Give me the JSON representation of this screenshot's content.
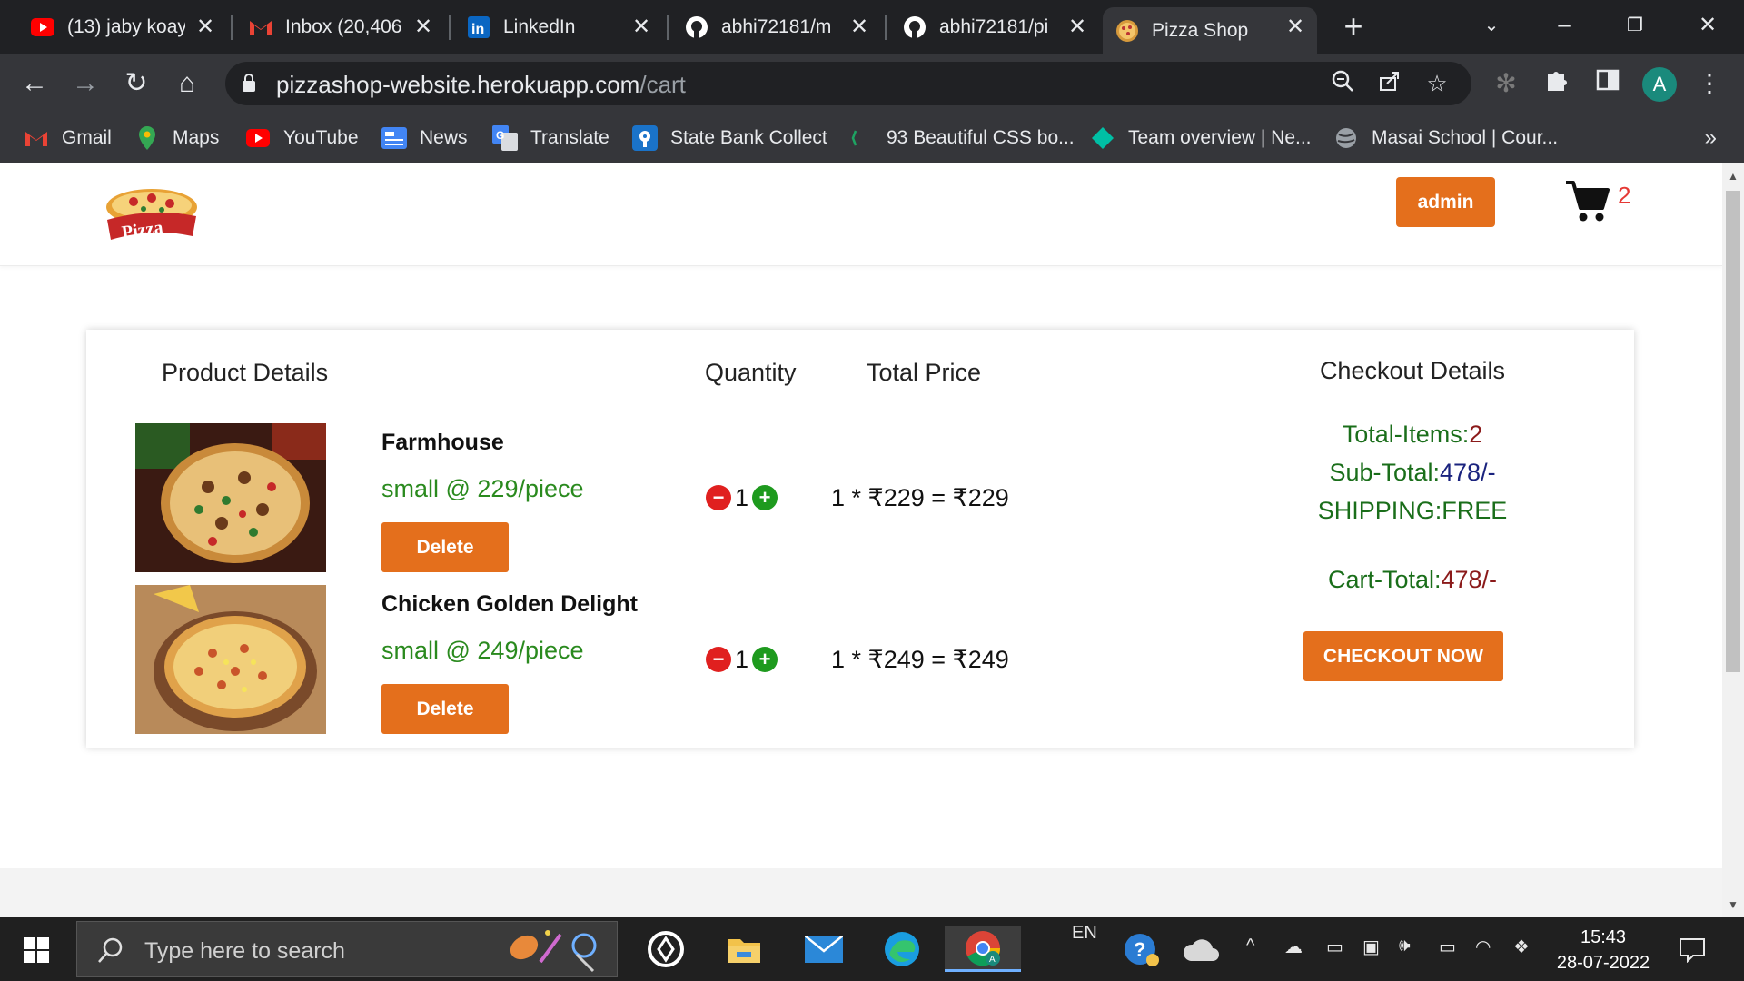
{
  "browser": {
    "tabs": [
      {
        "title": "(13) jaby koay",
        "icon": "youtube-icon"
      },
      {
        "title": "Inbox (20,406",
        "icon": "gmail-icon"
      },
      {
        "title": "LinkedIn",
        "icon": "linkedin-icon"
      },
      {
        "title": "abhi72181/m",
        "icon": "github-icon"
      },
      {
        "title": "abhi72181/pi",
        "icon": "github-icon"
      },
      {
        "title": "Pizza Shop",
        "icon": "pizza-icon",
        "active": true
      }
    ],
    "url_host": "pizzashop-website.herokuapp.com",
    "url_path": "/cart",
    "profile_initial": "A",
    "bookmarks": [
      {
        "label": "Gmail",
        "icon": "gmail-icon"
      },
      {
        "label": "Maps",
        "icon": "maps-icon"
      },
      {
        "label": "YouTube",
        "icon": "youtube-icon"
      },
      {
        "label": "News",
        "icon": "news-icon"
      },
      {
        "label": "Translate",
        "icon": "translate-icon"
      },
      {
        "label": "State Bank Collect",
        "icon": "sbi-icon"
      },
      {
        "label": "93 Beautiful CSS bo...",
        "icon": "css-icon"
      },
      {
        "label": "Team overview | Ne...",
        "icon": "diamond-icon"
      },
      {
        "label": "Masai School | Cour...",
        "icon": "globe-icon"
      }
    ],
    "bookmarks_more": "»"
  },
  "site": {
    "admin_label": "admin",
    "cart_count": "2",
    "headers": {
      "product": "Product Details",
      "quantity": "Quantity",
      "total": "Total Price",
      "checkout": "Checkout Details"
    },
    "items": [
      {
        "name": "Farmhouse",
        "variant": "small @ 229/piece",
        "delete_label": "Delete",
        "qty": "1",
        "line_total": "1 * ₹229 = ₹229"
      },
      {
        "name": "Chicken Golden Delight",
        "variant": "small @ 249/piece",
        "delete_label": "Delete",
        "qty": "1",
        "line_total": "1 * ₹249 = ₹249"
      }
    ],
    "checkout": {
      "total_items_label": "Total-Items:",
      "total_items_value": "2",
      "subtotal_label": "Sub-Total:",
      "subtotal_value": "478/-",
      "shipping_text": "SHIPPING:FREE",
      "cart_total_label": "Cart-Total:",
      "cart_total_value": "478/-",
      "button_label": "CHECKOUT NOW"
    }
  },
  "taskbar": {
    "search_placeholder": "Type here to search",
    "lang": "EN",
    "time": "15:43",
    "date": "28-07-2022"
  },
  "colors": {
    "accent": "#e46f1c",
    "green_text": "#2a8a1e",
    "minus": "#e0201f",
    "plus": "#1e9a1e"
  }
}
